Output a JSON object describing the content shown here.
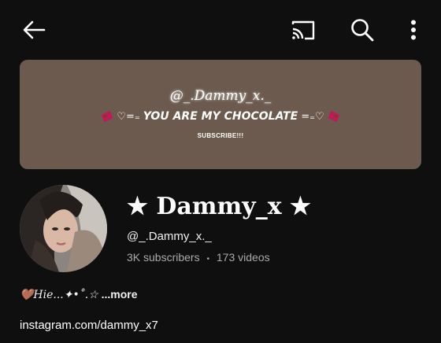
{
  "topbar": {
    "back_icon": "arrow-back-icon",
    "cast_icon": "cast-icon",
    "search_icon": "search-icon",
    "more_icon": "more-vert-icon"
  },
  "banner": {
    "handle": "@_.Dammy_x._",
    "heart_left": "♡=₌",
    "slogan": "YOU ARE MY CHOCOLATE",
    "heart_right": "=₌♡",
    "subscribe": "SUBSCRIBE!!!",
    "bg_color": "#6b5a4d"
  },
  "channel": {
    "name": "★ Dammy_x ★",
    "handle": "@_.Dammy_x._",
    "subscribers": "3K subscribers",
    "separator": "•",
    "videos": "173 videos"
  },
  "description": {
    "text": "🤎Hie...✦•˚.☆",
    "more_label": "...more"
  },
  "link": {
    "text": "instagram.com/dammy_x7"
  }
}
